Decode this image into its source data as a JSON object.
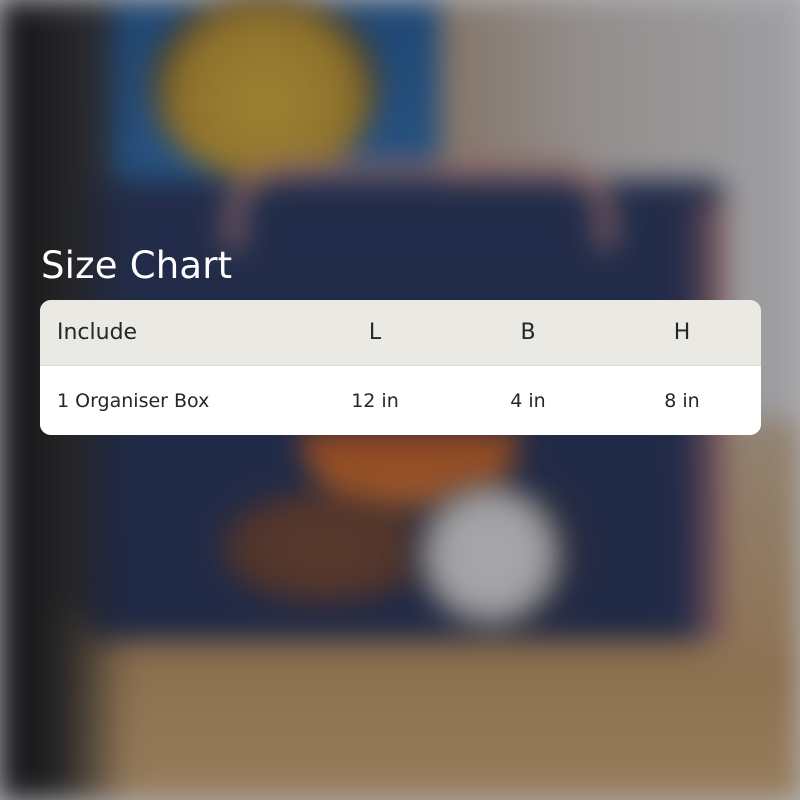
{
  "title": "Size Chart",
  "table": {
    "headers": [
      "Include",
      "L",
      "B",
      "H"
    ],
    "rows": [
      [
        "1 Organiser Box",
        "12 in",
        "4 in",
        "8 in"
      ]
    ]
  },
  "colors": {
    "title_text": "#ffffff",
    "header_bg": "#ebe9e4",
    "row_bg": "#ffffff",
    "cell_text": "#262626"
  }
}
